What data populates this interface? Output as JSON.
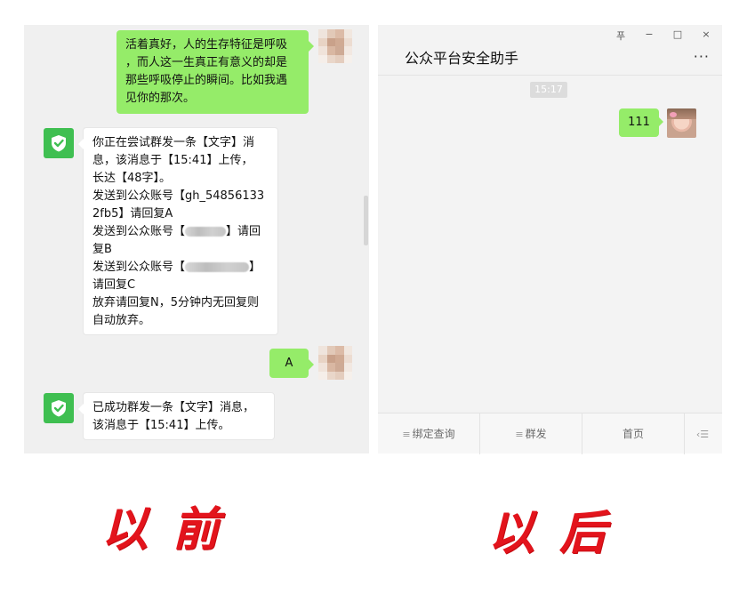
{
  "before_chat": {
    "msg_1": [
      "活着真好，人的生存特征是呼吸",
      "，而人这一生真正有意义的却是",
      "那些呼吸停止的瞬间。比如我遇",
      "见你的那次。"
    ],
    "msg_2": {
      "line_1": "你正在尝试群发一条【文字】消",
      "line_2": "息，该消息于【15:41】上传，",
      "line_3": "长达【48字】。",
      "line_4": "发送到公众账号【gh_54856133",
      "line_5": "2fb5】请回复A",
      "line_6_prefix": "发送到公众账号【",
      "line_6_suffix": "】请回",
      "line_7": "复B",
      "line_8_prefix": "发送到公众账号【",
      "line_8_suffix": "】",
      "line_9": "请回复C",
      "line_10": "放弃请回复N，5分钟内无回复则",
      "line_11": "自动放弃。"
    },
    "msg_3": "A",
    "msg_4": [
      "已成功群发一条【文字】消息，",
      "该消息于【15:41】上传。"
    ]
  },
  "after_chat": {
    "title": "公众平台安全助手",
    "window_controls": [
      "푸",
      "−",
      "□",
      "×"
    ],
    "more": "···",
    "timestamp": "15:17",
    "msg_1": "111",
    "tabs": [
      {
        "label": "绑定查询",
        "icon": "≡"
      },
      {
        "label": "群发",
        "icon": "≡"
      },
      {
        "label": "首页",
        "icon": ""
      },
      {
        "label": "",
        "icon": "‹☰"
      }
    ]
  },
  "labels": {
    "before": "以前",
    "after": "以后"
  },
  "colors": {
    "green_bubble": "#95ec69",
    "shield_green": "#3fbf51",
    "label_red": "#e3141c"
  },
  "icons": {
    "bot_avatar": "shield-check-icon",
    "user_avatar": "pixelated-avatar",
    "menu": "hamburger-icon"
  }
}
